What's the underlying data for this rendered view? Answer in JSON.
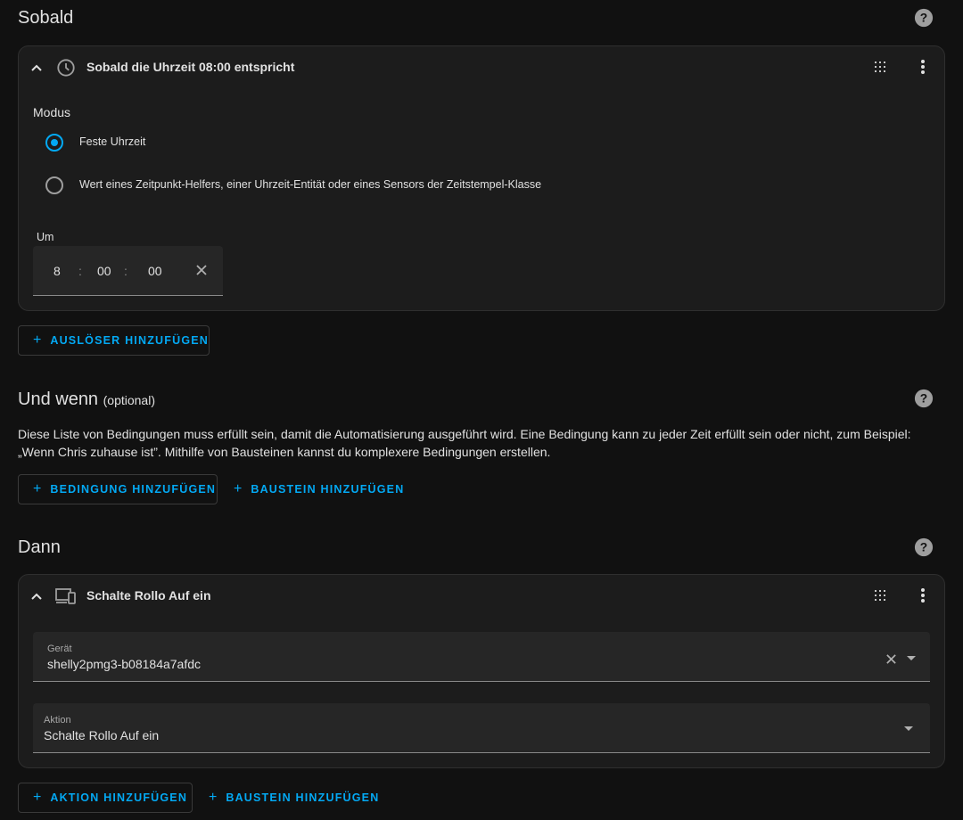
{
  "trigger_section": {
    "title": "Sobald",
    "card": {
      "title": "Sobald die Uhrzeit 08:00 entspricht",
      "mode_label": "Modus",
      "options": [
        {
          "label": "Feste Uhrzeit",
          "selected": true
        },
        {
          "label": "Wert eines Zeitpunkt-Helfers, einer Uhrzeit-Entität oder eines Sensors der Zeitstempel-Klasse",
          "selected": false
        }
      ],
      "time_label": "Um",
      "time": {
        "hours": "8",
        "minutes": "00",
        "seconds": "00",
        "separator": ":"
      }
    },
    "add_button": "AUSLÖSER HINZUFÜGEN"
  },
  "condition_section": {
    "title": "Und wenn",
    "title_suffix": "(optional)",
    "description_line1": "Diese Liste von Bedingungen muss erfüllt sein, damit die Automatisierung ausgeführt wird. Eine Bedingung kann zu jeder Zeit erfüllt sein oder nicht, zum Beispiel:",
    "description_line2": "„Wenn Chris zuhause ist”. Mithilfe von Bausteinen kannst du komplexere Bedingungen erstellen.",
    "add_condition_button": "BEDINGUNG HINZUFÜGEN",
    "add_block_button": "BAUSTEIN HINZUFÜGEN"
  },
  "action_section": {
    "title": "Dann",
    "card": {
      "title": "Schalte Rollo Auf ein",
      "device_label": "Gerät",
      "device_value": "shelly2pmg3-b08184a7afdc",
      "action_label": "Aktion",
      "action_value": "Schalte Rollo Auf ein"
    },
    "add_action_button": "AKTION HINZUFÜGEN",
    "add_block_button": "BAUSTEIN HINZUFÜGEN"
  },
  "plus_symbol": "+",
  "colors": {
    "background": "#111111",
    "card": "#1c1c1c",
    "accent": "#03a9f4",
    "text": "#e1e1e1",
    "icon": "#9e9e9e"
  }
}
